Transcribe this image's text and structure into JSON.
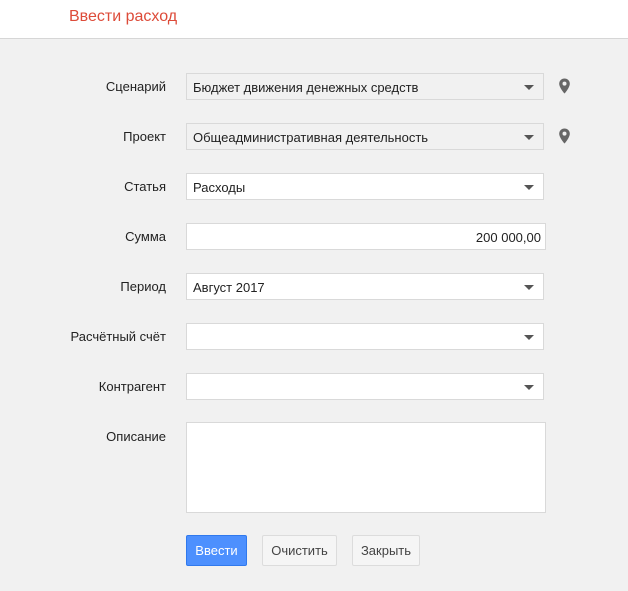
{
  "header": {
    "title": "Ввести расход"
  },
  "form": {
    "scenario": {
      "label": "Сценарий",
      "value": "Бюджет движения денежных средств",
      "icon": "map-pin-icon"
    },
    "project": {
      "label": "Проект",
      "value": "Общеадминистративная деятельность",
      "icon": "map-pin-icon"
    },
    "article": {
      "label": "Статья",
      "value": "Расходы"
    },
    "amount": {
      "label": "Сумма",
      "value": "200 000,00"
    },
    "period": {
      "label": "Период",
      "value": "Август 2017"
    },
    "account": {
      "label": "Расчётный счёт",
      "value": ""
    },
    "counterparty": {
      "label": "Контрагент",
      "value": ""
    },
    "description": {
      "label": "Описание",
      "value": ""
    }
  },
  "buttons": {
    "submit": "Ввести",
    "clear": "Очистить",
    "close": "Закрыть"
  },
  "colors": {
    "title": "#dd4b39",
    "primary_button": "#4d90fe",
    "background": "#f1f1f1"
  }
}
